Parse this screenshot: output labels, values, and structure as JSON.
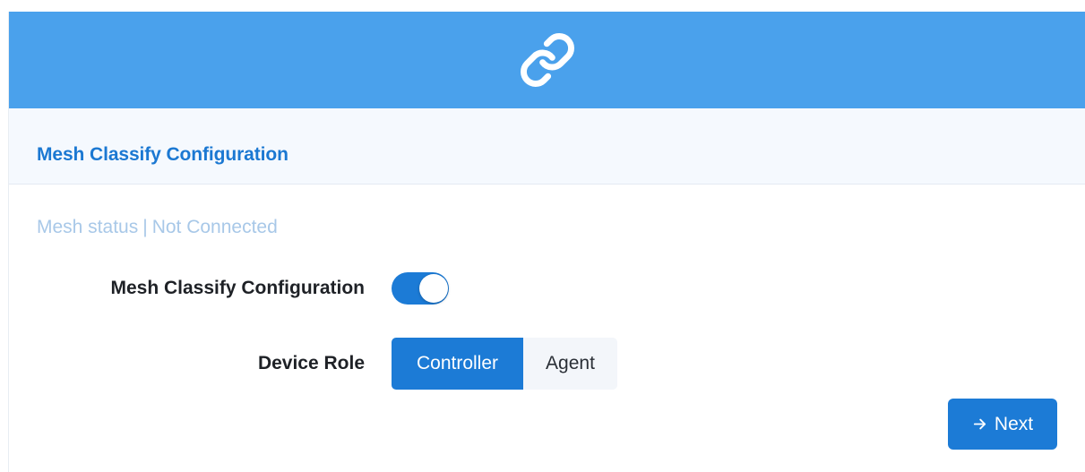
{
  "header": {
    "icon": "link-icon",
    "color": "#4aa1ec"
  },
  "section": {
    "title": "Mesh Classify Configuration"
  },
  "status": {
    "label": "Mesh status",
    "separator": "|",
    "value": "Not Connected"
  },
  "form": {
    "toggle_row": {
      "label": "Mesh Classify Configuration",
      "enabled": true
    },
    "role_row": {
      "label": "Device Role",
      "options": [
        "Controller",
        "Agent"
      ],
      "selected": "Controller"
    }
  },
  "actions": {
    "next_label": "Next",
    "next_icon": "arrow-right-icon"
  },
  "colors": {
    "accent": "#1c7bd6",
    "title_blue": "#1b78d2",
    "muted_status": "#a8c8e8"
  }
}
